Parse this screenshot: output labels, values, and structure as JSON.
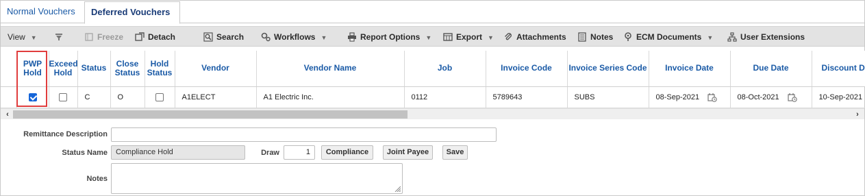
{
  "tabs": [
    {
      "label": "Normal Vouchers",
      "active": false
    },
    {
      "label": "Deferred Vouchers",
      "active": true
    }
  ],
  "toolbar": {
    "view": "View",
    "freeze": "Freeze",
    "detach": "Detach",
    "search": "Search",
    "workflows": "Workflows",
    "report_options": "Report Options",
    "export": "Export",
    "attachments": "Attachments",
    "notes": "Notes",
    "ecm_documents": "ECM Documents",
    "user_extensions": "User Extensions"
  },
  "grid": {
    "columns": {
      "pwp_hold": "PWP Hold",
      "exceed_hold": "Exceed Hold",
      "status": "Status",
      "close_status": "Close Status",
      "hold_status": "Hold Status",
      "vendor": "Vendor",
      "vendor_name": "Vendor Name",
      "job": "Job",
      "invoice_code": "Invoice Code",
      "invoice_series_code": "Invoice Series Code",
      "invoice_date": "Invoice Date",
      "due_date": "Due Date",
      "discount": "Discount D"
    },
    "row": {
      "pwp_hold": true,
      "exceed_hold": false,
      "status": "C",
      "close_status": "O",
      "hold_status": false,
      "vendor": "A1ELECT",
      "vendor_name": "A1 Electric Inc.",
      "job": "0112",
      "invoice_code": "5789643",
      "invoice_series_code": "SUBS",
      "invoice_date": "08-Sep-2021",
      "due_date": "08-Oct-2021",
      "discount": "10-Sep-2021"
    }
  },
  "form": {
    "remittance_label": "Remittance Description",
    "remittance_value": "",
    "status_name_label": "Status Name",
    "status_name_value": "Compliance Hold",
    "draw_label": "Draw",
    "draw_value": "1",
    "compliance_button": "Compliance",
    "joint_payee_button": "Joint Payee",
    "save_button": "Save",
    "notes_label": "Notes",
    "notes_value": ""
  },
  "colors": {
    "accent": "#1a5aa6",
    "highlight": "#e03c3c",
    "checkbox_on": "#1565d8"
  }
}
